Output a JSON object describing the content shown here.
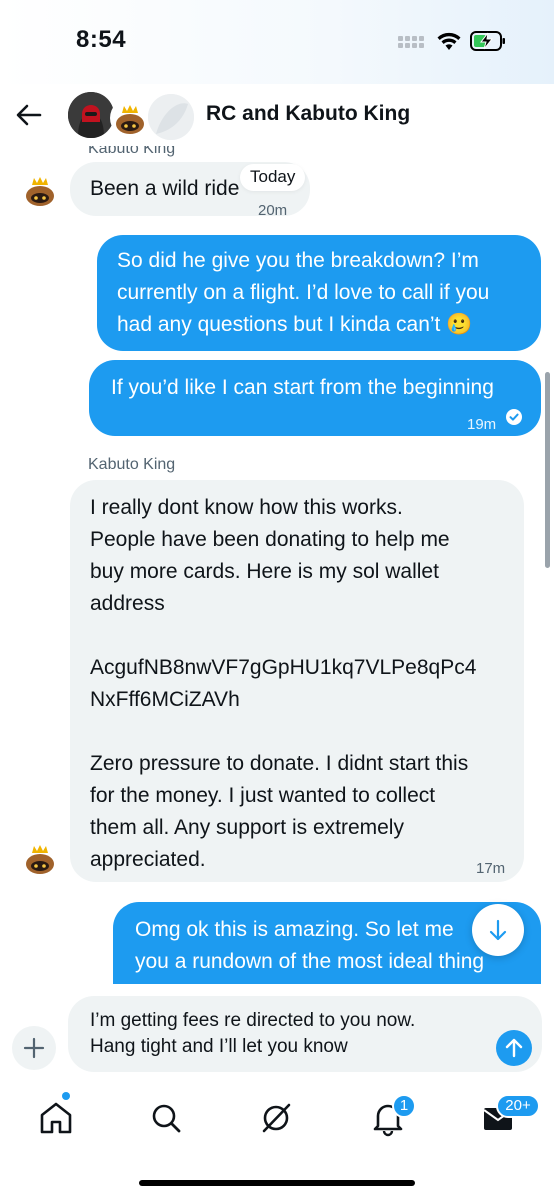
{
  "status_bar": {
    "time": "8:54"
  },
  "header": {
    "title": "RC and Kabuto King"
  },
  "chat": {
    "date_divider": "Today",
    "messages": [
      {
        "sender": "Kabuto King",
        "text": "Been a wild ride",
        "time": "20m"
      },
      {
        "text": "So did he give you the breakdown? I’m\ncurrently on a flight. I’d love to call if you\nhad any questions but I kinda can’t 🥲"
      },
      {
        "text": "If you’d like I can start from the beginning",
        "time": "19m"
      },
      {
        "sender": "Kabuto King",
        "text": "I really dont know how this works.\nPeople have been donating to help me\nbuy more cards. Here is my sol wallet\naddress\n\nAcgufNB8nwVF7gGpHU1kq7VLPe8qPc4\nNxFff6MCiZAVh\n\nZero pressure to donate. I didnt start this\nfor the money. I just wanted to collect\nthem all. Any support is extremely\nappreciated.",
        "time": "17m"
      },
      {
        "text": "Omg ok this is amazing. So let me\nyou a rundown of the most ideal thing"
      }
    ]
  },
  "composer": {
    "text": "I’m getting fees re directed to you now.\nHang tight and I’ll let you know"
  },
  "tabbar": {
    "notifications_badge": "1",
    "messages_badge": "20+",
    "items": [
      "home-icon",
      "search-icon",
      "grok-icon",
      "bell-icon",
      "mail-icon"
    ]
  },
  "colors": {
    "accent": "#1d9bf0",
    "incoming_bubble": "#eff3f4",
    "text": "#0f1419",
    "muted": "#536471"
  }
}
